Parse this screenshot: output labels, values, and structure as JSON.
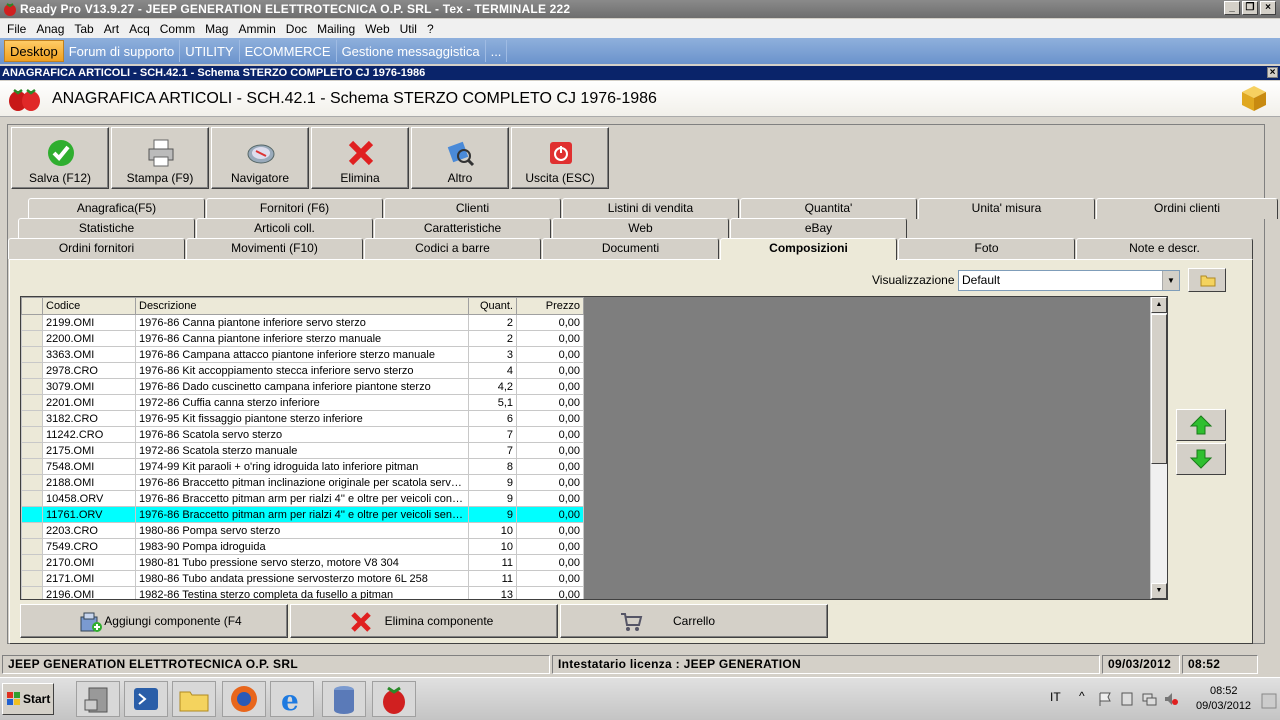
{
  "window": {
    "title": "Ready Pro V13.9.27 - JEEP GENERATION ELETTROTECNICA O.P. SRL - Tex - TERMINALE 222"
  },
  "menu": [
    "File",
    "Anag",
    "Tab",
    "Art",
    "Acq",
    "Comm",
    "Mag",
    "Ammin",
    "Doc",
    "Mailing",
    "Web",
    "Util",
    "?"
  ],
  "desktop_tabs": [
    "Desktop",
    "Forum di supporto",
    "UTILITY",
    "ECOMMERCE",
    "Gestione messaggistica",
    "..."
  ],
  "form": {
    "caption": "ANAGRAFICA ARTICOLI - SCH.42.1 - Schema STERZO COMPLETO CJ 1976-1986",
    "title": "ANAGRAFICA ARTICOLI - SCH.42.1 - Schema STERZO COMPLETO CJ 1976-1986"
  },
  "toolbar": {
    "save": "Salva (F12)",
    "print": "Stampa (F9)",
    "navigator": "Navigatore",
    "delete": "Elimina",
    "other": "Altro",
    "exit": "Uscita (ESC)"
  },
  "tabs": {
    "row1": [
      "Anagrafica(F5)",
      "Fornitori (F6)",
      "Clienti",
      "Listini di vendita",
      "Quantita'",
      "Unita' misura",
      "Ordini clienti"
    ],
    "row2": [
      "Statistiche",
      "Articoli coll.",
      "Caratteristiche",
      "Web",
      "eBay"
    ],
    "row3": [
      "Ordini fornitori",
      "Movimenti (F10)",
      "Codici a barre",
      "Documenti",
      "Composizioni",
      "Foto",
      "Note e descr."
    ]
  },
  "view": {
    "label": "Visualizzazione :",
    "value": "Default"
  },
  "grid": {
    "columns": [
      "Codice",
      "Descrizione",
      "Quant.",
      "Prezzo"
    ],
    "rows": [
      [
        "2199.OMI",
        "1976-86 Canna piantone inferiore servo sterzo",
        "2",
        "0,00"
      ],
      [
        "2200.OMI",
        "1976-86 Canna piantone inferiore sterzo manuale",
        "2",
        "0,00"
      ],
      [
        "3363.OMI",
        "1976-86 Campana attacco piantone inferiore sterzo manuale",
        "3",
        "0,00"
      ],
      [
        "2978.CRO",
        "1976-86 Kit accoppiamento stecca inferiore servo sterzo",
        "4",
        "0,00"
      ],
      [
        "3079.OMI",
        "1976-86 Dado cuscinetto campana inferiore piantone sterzo",
        "4,2",
        "0,00"
      ],
      [
        "2201.OMI",
        "1972-86 Cuffia canna sterzo inferiore",
        "5,1",
        "0,00"
      ],
      [
        "3182.CRO",
        "1976-95 Kit fissaggio piantone sterzo inferiore",
        "6",
        "0,00"
      ],
      [
        "11242.CRO",
        "1976-86 Scatola servo sterzo",
        "7",
        "0,00"
      ],
      [
        "2175.OMI",
        "1972-86 Scatola sterzo manuale",
        "7",
        "0,00"
      ],
      [
        "7548.OMI",
        "1974-99 Kit paraoli + o'ring idroguida lato inferiore pitman",
        "8",
        "0,00"
      ],
      [
        "2188.OMI",
        "1976-86 Braccetto pitman inclinazione originale per scatola servo st...",
        "9",
        "0,00"
      ],
      [
        "10458.ORV",
        "1976-86 Braccetto pitman arm per rialzi 4'' e oltre per veicoli con ser...",
        "9",
        "0,00"
      ],
      [
        "11761.ORV",
        "1976-86 Braccetto pitman arm per rialzi 4'' e oltre per veicoli senza ...",
        "9",
        "0,00"
      ],
      [
        "2203.CRO",
        "1980-86 Pompa servo sterzo",
        "10",
        "0,00"
      ],
      [
        "7549.CRO",
        "1983-90 Pompa idroguida",
        "10",
        "0,00"
      ],
      [
        "2170.OMI",
        "1980-81 Tubo pressione servo sterzo, motore V8 304",
        "11",
        "0,00"
      ],
      [
        "2171.OMI",
        "1980-86 Tubo andata pressione servosterzo  motore 6L 258",
        "11",
        "0,00"
      ],
      [
        "2196.OMI",
        "1982-86 Testina sterzo completa da fusello a pitman",
        "13",
        "0,00"
      ]
    ],
    "highlighted_row": 12
  },
  "bottom_buttons": {
    "add": "Aggiungi componente (F4",
    "remove": "Elimina componente",
    "cart": "Carrello"
  },
  "statusbar": {
    "company": "JEEP GENERATION ELETTROTECNICA O.P. SRL",
    "license": "Intestatario licenza : JEEP GENERATION",
    "date": "09/03/2012",
    "time": "08:52"
  },
  "taskbar": {
    "start": "Start",
    "lang": "IT",
    "clock_time": "08:52",
    "clock_date": "09/03/2012"
  },
  "colors": {
    "highlight": "#00ffff",
    "caption_bg": "#0a246a",
    "active_tab": "#f0a020"
  }
}
